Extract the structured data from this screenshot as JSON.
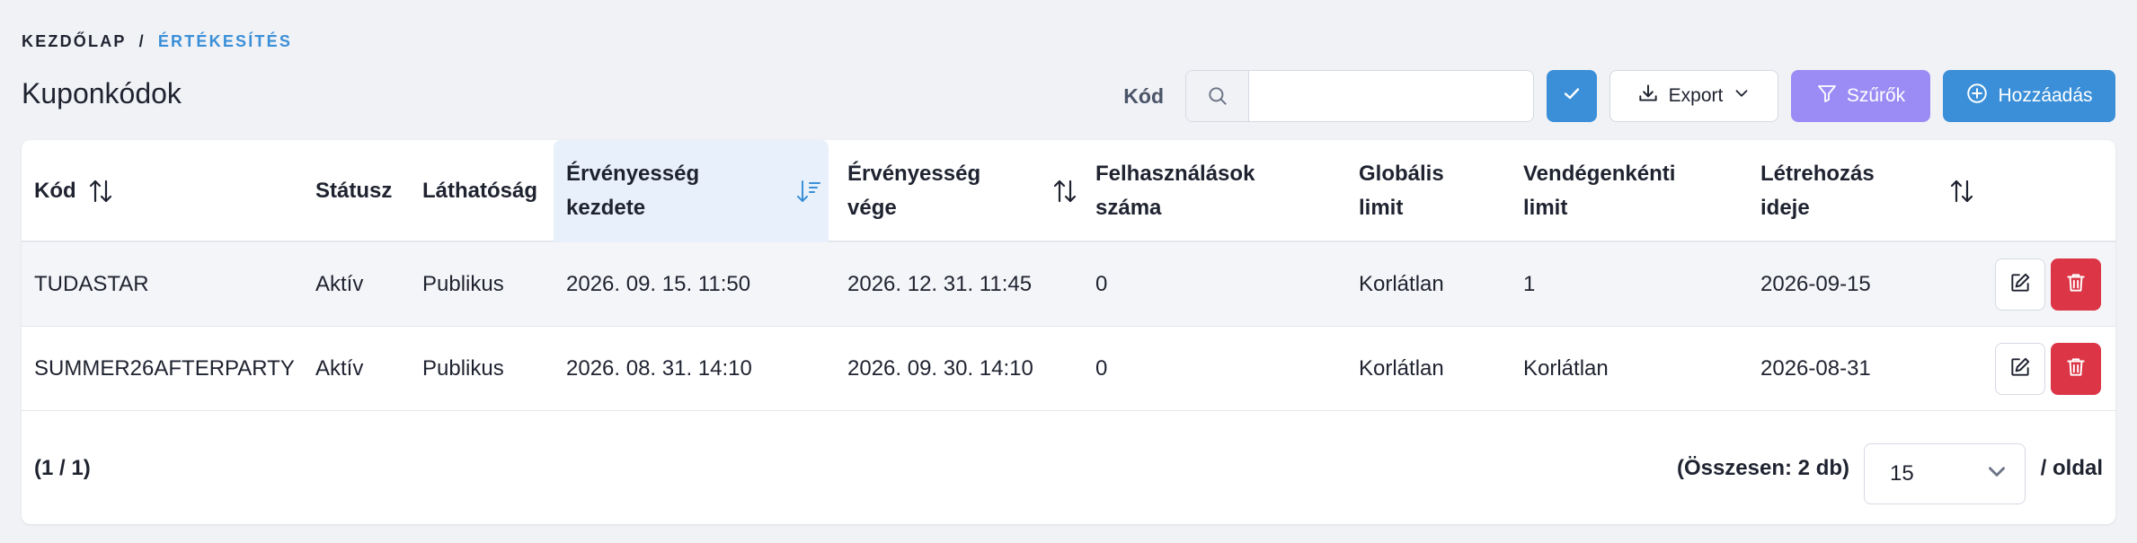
{
  "breadcrumb": {
    "home": "KEZDŐLAP",
    "separator": "/",
    "current": "ÉRTÉKESÍTÉS"
  },
  "page": {
    "title": "Kuponkódok"
  },
  "toolbar": {
    "code_label": "Kód",
    "search_value": "",
    "search_placeholder": "",
    "export_label": "Export",
    "filter_label": "Szűrők",
    "add_label": "Hozzáadás",
    "icons": [
      "search-icon",
      "check-icon",
      "download-icon",
      "chevron-down-icon",
      "filter-icon",
      "plus-circle-icon"
    ]
  },
  "table": {
    "columns": [
      {
        "line1": "Kód",
        "line2": ""
      },
      {
        "line1": "Státusz",
        "line2": ""
      },
      {
        "line1": "Láthatóság",
        "line2": ""
      },
      {
        "line1": "Érvényesség",
        "line2": "kezdete"
      },
      {
        "line1": "Érvényesség",
        "line2": "vége"
      },
      {
        "line1": "Felhasználások",
        "line2": "száma"
      },
      {
        "line1": "Globális",
        "line2": "limit"
      },
      {
        "line1": "Vendégenkénti",
        "line2": "limit"
      },
      {
        "line1": "Létrehozás",
        "line2": "ideje"
      }
    ],
    "sorted_column": "Érvényesség kezdete",
    "rows": [
      {
        "code": "TUDASTAR",
        "status": "Aktív",
        "visibility": "Publikus",
        "valid_from": "2026. 09. 15. 11:50",
        "valid_to": "2026. 12. 31. 11:45",
        "usage_count": "0",
        "global_limit": "Korlátlan",
        "guest_limit": "1",
        "created": "2026-09-15"
      },
      {
        "code": "SUMMER26AFTERPARTY",
        "status": "Aktív",
        "visibility": "Publikus",
        "valid_from": "2026. 08. 31. 14:10",
        "valid_to": "2026. 09. 30. 14:10",
        "usage_count": "0",
        "global_limit": "Korlátlan",
        "guest_limit": "Korlátlan",
        "created": "2026-08-31"
      }
    ]
  },
  "footer": {
    "page_info": "(1 / 1)",
    "total": "(Összesen: 2 db)",
    "per_page": "15",
    "per_page_suffix": "/ oldal"
  },
  "colors": {
    "primary": "#3a8fd8",
    "filter": "#9b8cf5",
    "danger": "#dc3545",
    "background": "#f1f2f6"
  }
}
